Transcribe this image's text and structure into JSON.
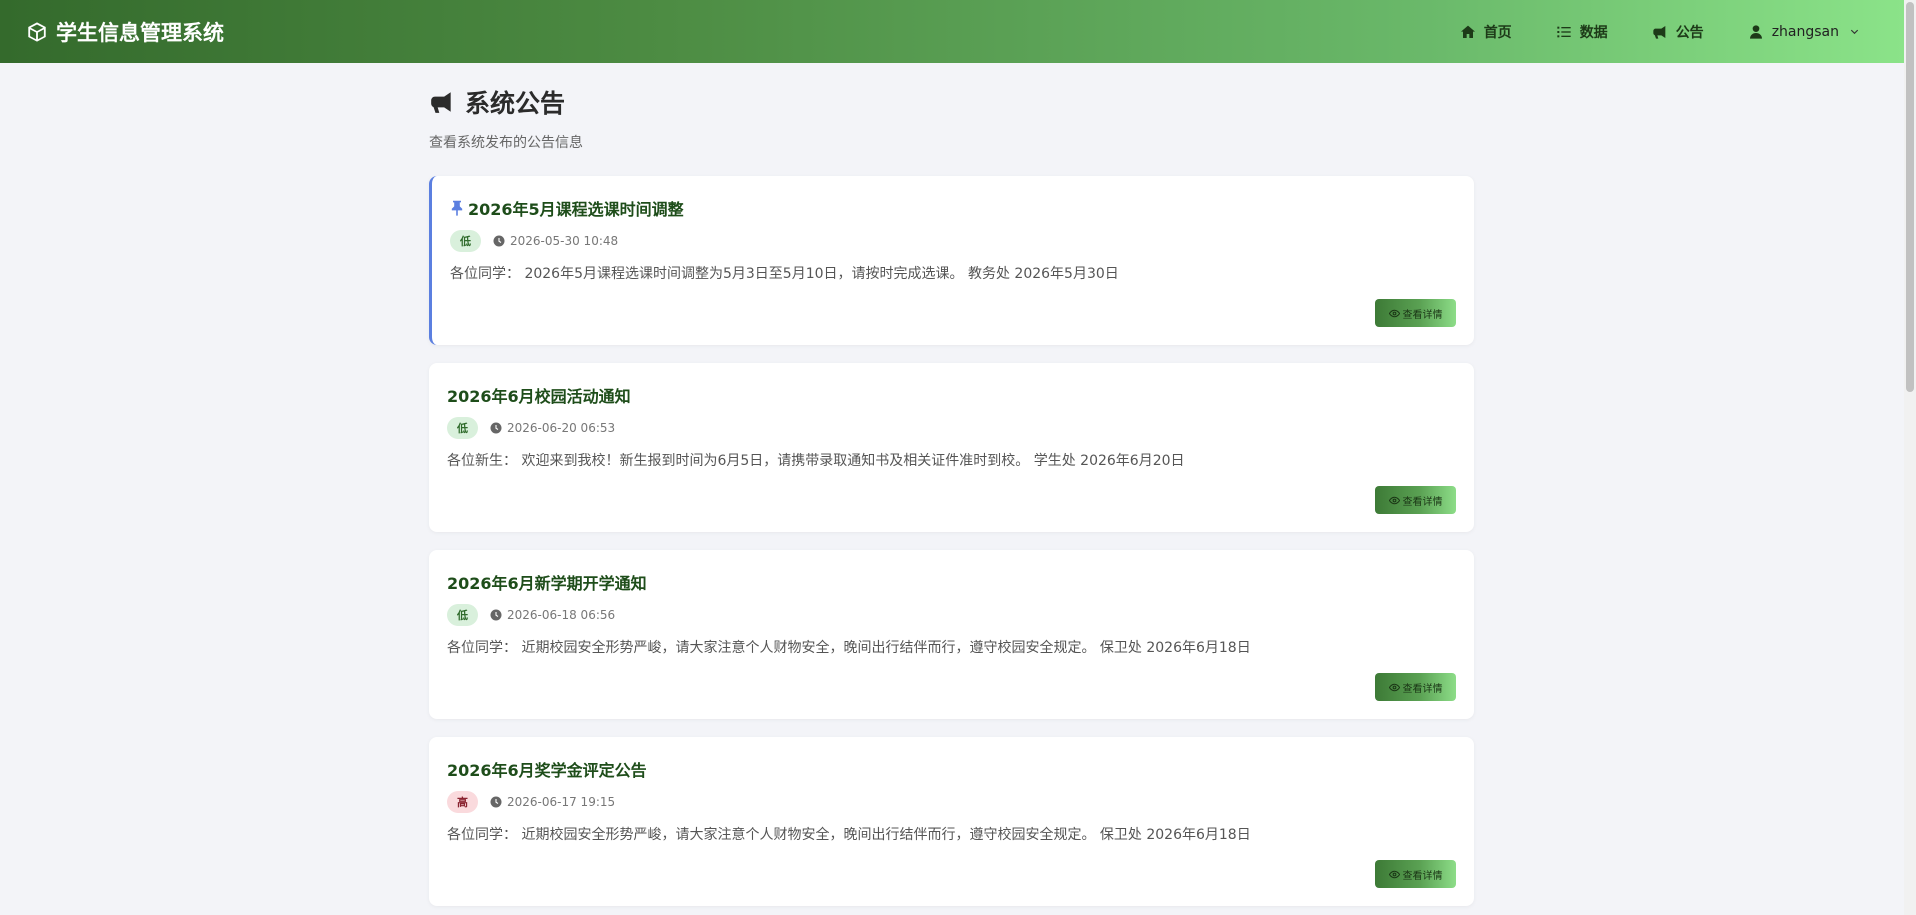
{
  "brand": {
    "title": "学生信息管理系统",
    "icon": "cube-icon"
  },
  "nav": {
    "items": [
      {
        "label": "首页",
        "icon": "home-icon"
      },
      {
        "label": "数据",
        "icon": "list-icon"
      },
      {
        "label": "公告",
        "icon": "megaphone-icon"
      }
    ],
    "user": {
      "name": "zhangsan",
      "icon": "user-icon"
    }
  },
  "page": {
    "title": "系统公告",
    "subtitle": "查看系统发布的公告信息"
  },
  "colors": {
    "navbar_start": "#346a2c",
    "navbar_end": "#8be389",
    "title_green": "#1e4d1a",
    "pinned_border": "#5b7fe0",
    "badge_low_bg": "#d9f0dc",
    "badge_high_bg": "#fadadd"
  },
  "announcements": [
    {
      "title": "2026年5月课程选课时间调整",
      "pinned": true,
      "priority": "低",
      "priority_level": "low",
      "time": "2026-05-30 10:48",
      "content": "各位同学： 2026年5月课程选课时间调整为5月3日至5月10日，请按时完成选课。 教务处 2026年5月30日",
      "button": "查看详情"
    },
    {
      "title": "2026年6月校园活动通知",
      "pinned": false,
      "priority": "低",
      "priority_level": "low",
      "time": "2026-06-20 06:53",
      "content": "各位新生： 欢迎来到我校！新生报到时间为6月5日，请携带录取通知书及相关证件准时到校。 学生处 2026年6月20日",
      "button": "查看详情"
    },
    {
      "title": "2026年6月新学期开学通知",
      "pinned": false,
      "priority": "低",
      "priority_level": "low",
      "time": "2026-06-18 06:56",
      "content": "各位同学： 近期校园安全形势严峻，请大家注意个人财物安全，晚间出行结伴而行，遵守校园安全规定。 保卫处 2026年6月18日",
      "button": "查看详情"
    },
    {
      "title": "2026年6月奖学金评定公告",
      "pinned": false,
      "priority": "高",
      "priority_level": "high",
      "time": "2026-06-17 19:15",
      "content": "各位同学： 近期校园安全形势严峻，请大家注意个人财物安全，晚间出行结伴而行，遵守校园安全规定。 保卫处 2026年6月18日",
      "button": "查看详情"
    }
  ]
}
